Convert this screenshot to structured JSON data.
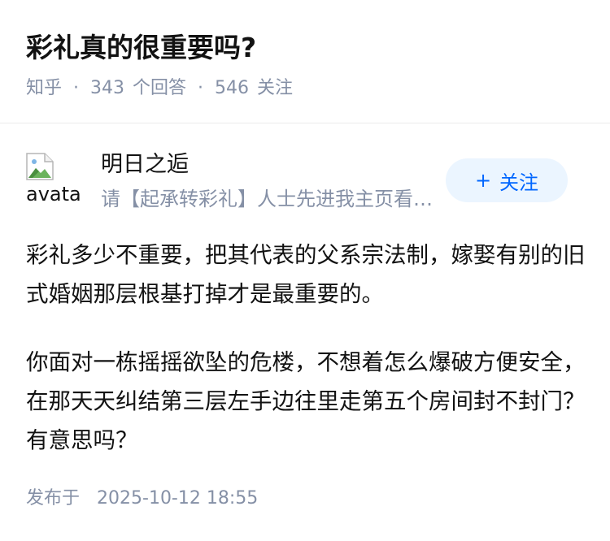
{
  "question": {
    "title": "彩礼真的很重要吗?",
    "source": "知乎",
    "separator": "·",
    "answer_count": "343",
    "answer_label": "个回答",
    "follower_count": "546",
    "follower_label": "关注"
  },
  "answer": {
    "author": {
      "name": "明日之逅",
      "bio": "请【起承转彩礼】人士先进我主页看看我对彩礼的态度",
      "avatar_alt": "avatar"
    },
    "follow_button": {
      "plus": "+",
      "label": "关注"
    },
    "paragraphs": [
      "彩礼多少不重要，把其代表的父系宗法制，嫁娶有别的旧式婚姻那层根基打掉才是最重要的。",
      "你面对一栋摇摇欲坠的危楼，不想着怎么爆破方便安全，在那天天纠结第三层左手边往里走第五个房间封不封门？有意思吗？"
    ],
    "publish_label": "发布于",
    "publish_time": "2025-10-12 18:55"
  },
  "colors": {
    "text": "#121212",
    "meta": "#8590a6",
    "accent": "#0066ff",
    "follow_bg": "#ebf5ff",
    "divider": "#ebebeb"
  },
  "icons": {
    "avatar": "broken-image-icon",
    "follow": "plus-icon"
  }
}
